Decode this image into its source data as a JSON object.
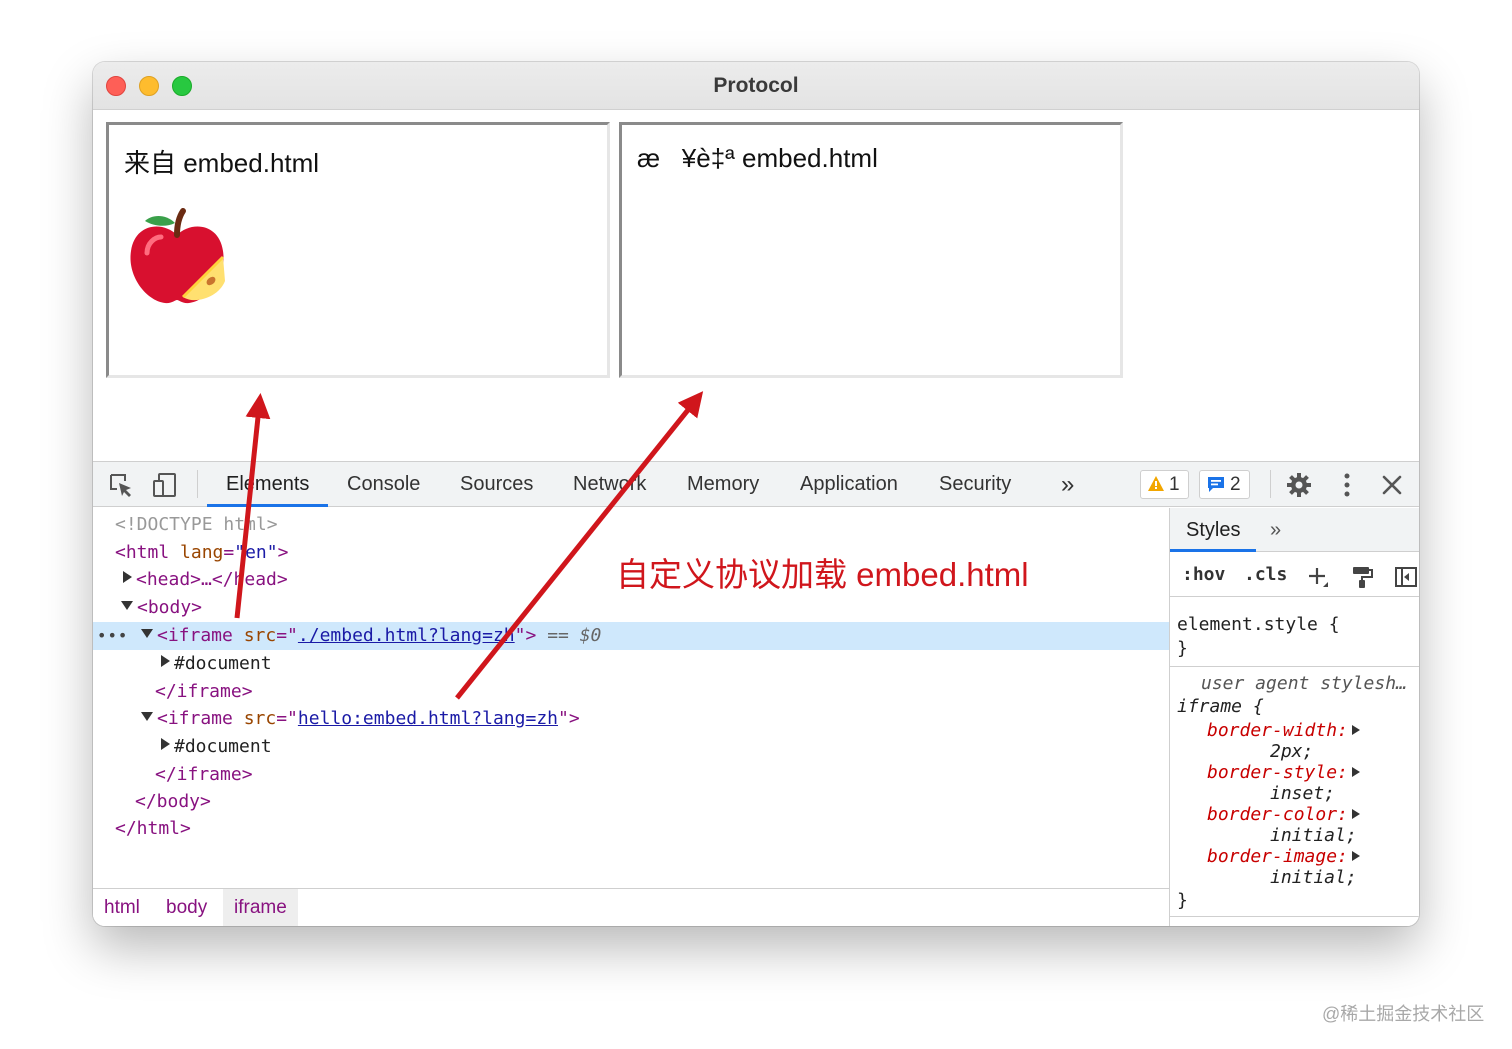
{
  "window": {
    "title": "Protocol"
  },
  "frames": [
    {
      "text": "来自 embed.html"
    },
    {
      "text": "æ   ¥è‡ª embed.html"
    }
  ],
  "devtools": {
    "tabs": [
      "Elements",
      "Console",
      "Sources",
      "Network",
      "Memory",
      "Application",
      "Security"
    ],
    "active_tab": "Elements",
    "more": "»",
    "warnings": "1",
    "messages": "2",
    "dom": {
      "doctype": "<!DOCTYPE html>",
      "html_open": "<html",
      "lang_attr": "lang",
      "lang_value": "\"en\"",
      "html_open_end": ">",
      "head": "<head>…</head>",
      "body_open": "<body>",
      "iframe1_open": "<iframe",
      "src_attr": "src",
      "iframe1_src": "./embed.html?lang=zh",
      "iframe1_end": "\">",
      "selected_marker": "== $0",
      "document": "#document",
      "iframe_close": "</iframe>",
      "iframe2_src": "hello:embed.html?lang=zh",
      "body_close": "</body>",
      "html_close": "</html>"
    },
    "breadcrumbs": [
      "html",
      "body",
      "iframe"
    ],
    "styles": {
      "tab": "Styles",
      "more": "»",
      "hov": ":hov",
      "cls": ".cls",
      "element_style": "element.style {",
      "close_brace": "}",
      "ua_label": "user agent stylesh…",
      "selector": "iframe {",
      "rules": [
        {
          "prop": "border-width:",
          "value": "2px;"
        },
        {
          "prop": "border-style:",
          "value": "inset;"
        },
        {
          "prop": "border-color:",
          "value": "initial;"
        },
        {
          "prop": "border-image:",
          "value": "initial;"
        }
      ]
    }
  },
  "annotation": "自定义协议加载 embed.html",
  "watermark": "@稀土掘金技术社区",
  "colors": {
    "accent": "#1a73e8",
    "arrow": "#d0161c",
    "tag": "#881280"
  }
}
